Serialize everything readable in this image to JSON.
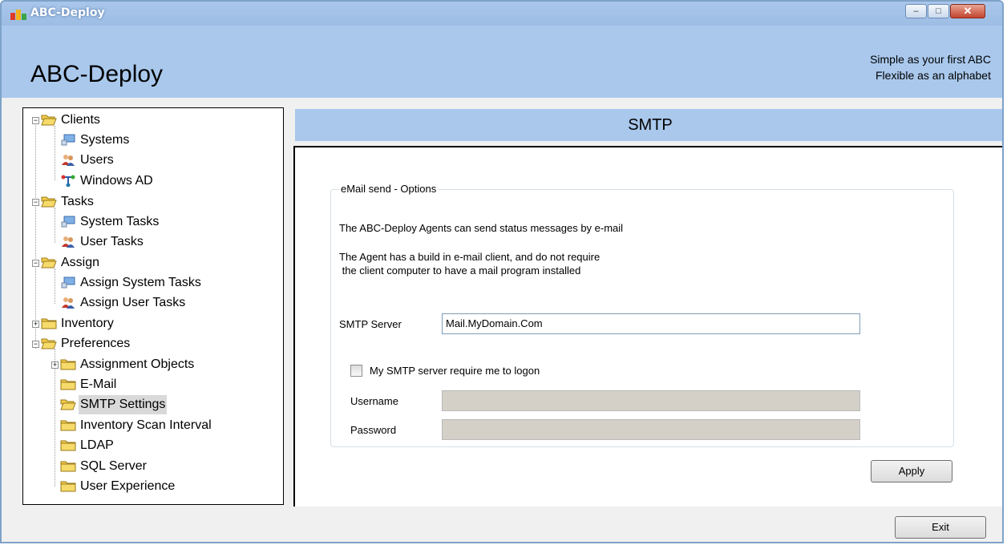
{
  "window": {
    "title": "ABC-Deploy",
    "controls": {
      "minimize": "–",
      "maximize": "□",
      "close": "✕"
    }
  },
  "header": {
    "app_title": "ABC-Deploy",
    "tagline_line1": "Simple as your first ABC",
    "tagline_line2": "Flexible as an alphabet"
  },
  "tree": {
    "items": [
      {
        "label": "Clients",
        "icon": "open-folder-icon"
      },
      {
        "label": "Systems",
        "icon": "computer-icon"
      },
      {
        "label": "Users",
        "icon": "users-icon"
      },
      {
        "label": "Windows AD",
        "icon": "network-icon"
      },
      {
        "label": "Tasks",
        "icon": "open-folder-icon"
      },
      {
        "label": "System Tasks",
        "icon": "computer-icon"
      },
      {
        "label": "User Tasks",
        "icon": "users-icon"
      },
      {
        "label": "Assign",
        "icon": "open-folder-icon"
      },
      {
        "label": "Assign System Tasks",
        "icon": "computer-icon"
      },
      {
        "label": "Assign User Tasks",
        "icon": "users-icon"
      },
      {
        "label": "Inventory",
        "icon": "folder-icon"
      },
      {
        "label": "Preferences",
        "icon": "open-folder-icon"
      },
      {
        "label": "Assignment Objects",
        "icon": "folder-icon"
      },
      {
        "label": "E-Mail",
        "icon": "folder-icon"
      },
      {
        "label": "SMTP Settings",
        "icon": "open-folder-icon",
        "selected": true
      },
      {
        "label": "Inventory Scan Interval",
        "icon": "folder-icon"
      },
      {
        "label": "LDAP",
        "icon": "folder-icon"
      },
      {
        "label": "SQL Server",
        "icon": "folder-icon"
      },
      {
        "label": "User Experience",
        "icon": "folder-icon"
      }
    ]
  },
  "panel": {
    "title": "SMTP",
    "group_title": "eMail send - Options",
    "info_line1": "The ABC-Deploy Agents can send status messages by e-mail",
    "info_line2": "The Agent has a build in e-mail client, and do not require",
    "info_line3": " the client computer to have a mail program installed",
    "smtp_server_label": "SMTP Server",
    "smtp_server_value": "Mail.MyDomain.Com",
    "logon_checkbox_label": "My SMTP server require me to logon",
    "logon_checked": false,
    "username_label": "Username",
    "username_value": "",
    "password_label": "Password",
    "password_value": "",
    "apply_label": "Apply"
  },
  "footer": {
    "exit_label": "Exit"
  },
  "colors": {
    "header_band": "#a9c8ec",
    "client_background": "#f0f0f0",
    "folder_yellow": "#f2cc4a",
    "selection": "#d9d9d9"
  }
}
